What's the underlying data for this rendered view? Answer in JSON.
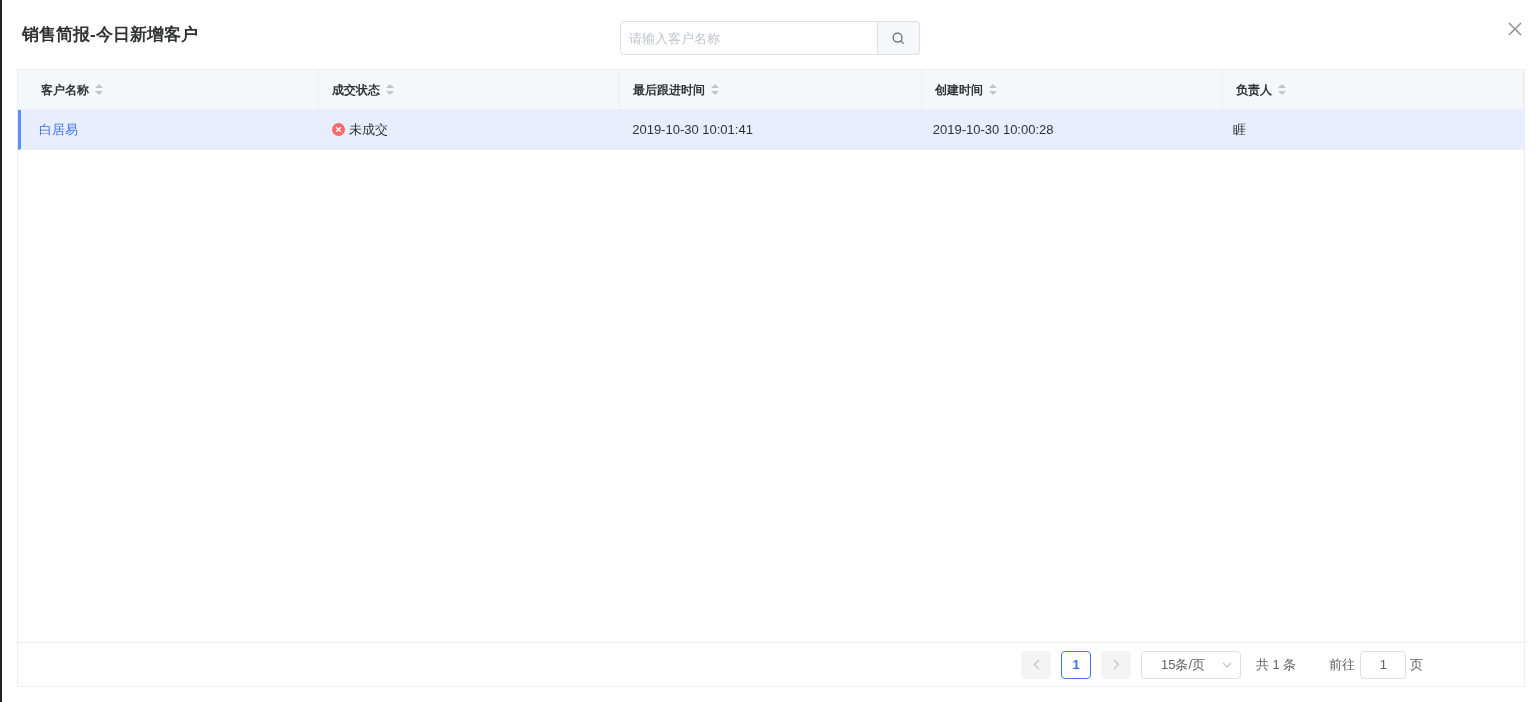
{
  "dialog": {
    "title": "销售简报-今日新增客户"
  },
  "search": {
    "placeholder": "请输入客户名称"
  },
  "table": {
    "columns": [
      {
        "label": "客户名称"
      },
      {
        "label": "成交状态"
      },
      {
        "label": "最后跟进时间"
      },
      {
        "label": "创建时间"
      },
      {
        "label": "负责人"
      }
    ],
    "rows": [
      {
        "selected": true,
        "customer": "白居易",
        "status": {
          "kind": "failed",
          "text": "未成交"
        },
        "last_follow_up": "2019-10-30 10:01:41",
        "created": "2019-10-30 10:00:28",
        "owner": "睚"
      }
    ]
  },
  "pagination": {
    "pages": [
      {
        "label": "1",
        "selected": true
      }
    ],
    "page_size": "15条/页",
    "total": "共 1 条",
    "goto_label": "前往",
    "goto_value": "1",
    "page_unit": "页"
  }
}
